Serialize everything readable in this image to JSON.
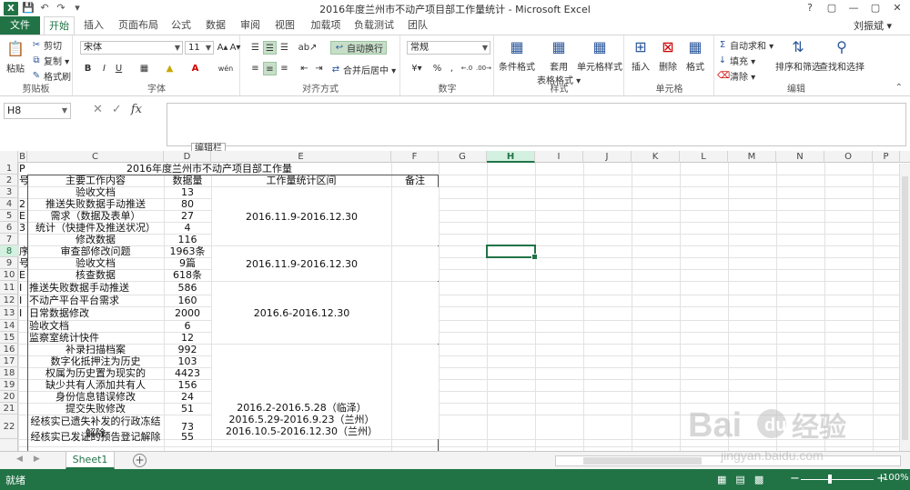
{
  "window": {
    "title": "2016年度兰州市不动产项目部工作量统计 - Microsoft Excel",
    "controls": [
      "?",
      "▢",
      "—",
      "▢",
      "✕"
    ]
  },
  "tabs": [
    {
      "label": "文件"
    },
    {
      "label": "开始"
    },
    {
      "label": "插入"
    },
    {
      "label": "页面布局"
    },
    {
      "label": "公式"
    },
    {
      "label": "数据"
    },
    {
      "label": "审阅"
    },
    {
      "label": "视图"
    },
    {
      "label": "加载项"
    },
    {
      "label": "负载测试"
    },
    {
      "label": "团队"
    }
  ],
  "user": "刘振斌 ▾",
  "ribbon": {
    "clipboard": {
      "label": "剪贴板",
      "paste": "粘贴",
      "cut": "剪切",
      "copy": "复制 ▾",
      "format_painter": "格式刷"
    },
    "font": {
      "label": "字体",
      "name": "宋体",
      "size": "11",
      "grow": "A▴",
      "shrink": "A▾",
      "bold": "B",
      "italic": "I",
      "underline": "U",
      "phonetic": "wén"
    },
    "alignment": {
      "label": "对齐方式",
      "wrap": "自动换行",
      "merge": "合并后居中 ▾"
    },
    "number": {
      "label": "数字",
      "format": "常规",
      "percent": "%",
      "comma": ",",
      "inc": "←.0",
      "dec": ".00→"
    },
    "styles": {
      "label": "样式",
      "cond": "条件格式",
      "table": "套用\n表格格式 ▾",
      "cell": "单元格样式"
    },
    "cells": {
      "label": "单元格",
      "insert": "插入",
      "delete": "删除",
      "format": "格式"
    },
    "editing": {
      "label": "编辑",
      "autosum": "自动求和 ▾",
      "fill": "填充 ▾",
      "clear": "清除 ▾",
      "sort": "排序和筛选",
      "find": "查找和选择"
    }
  },
  "formula_bar": {
    "name_box": "H8",
    "fx": "fx",
    "tooltip": "编辑栏"
  },
  "columns": [
    "B",
    "C",
    "D",
    "E",
    "F",
    "G",
    "H",
    "I",
    "J",
    "K",
    "L",
    "M",
    "N",
    "O",
    "P"
  ],
  "rows": [
    "1",
    "2",
    "3",
    "4",
    "5",
    "6",
    "7",
    "8",
    "9",
    "10",
    "11",
    "12",
    "13",
    "14",
    "15",
    "16",
    "17",
    "18",
    "19",
    "20",
    "21",
    "22"
  ],
  "sheet": {
    "title": "2016年度兰州市不动产项目部工作量",
    "headers": {
      "c": "主要工作内容",
      "d": "数据量",
      "e": "工作量统计区间",
      "f": "备注"
    },
    "rows": [
      {
        "c": "验收文档",
        "d": "13"
      },
      {
        "c": "推送失败数据手动推送",
        "d": "80"
      },
      {
        "c": "需求（数据及表单）",
        "d": "27"
      },
      {
        "c": "统计（快捷件及推送状况）",
        "d": "4"
      },
      {
        "c": "修改数据",
        "d": "116"
      },
      {
        "c": "审查部修改问题",
        "d": "1963条"
      },
      {
        "c": "验收文档",
        "d": "9篇"
      },
      {
        "c": "核查数据",
        "d": "618条"
      },
      {
        "c": "推送失败数据手动推送",
        "d": "586"
      },
      {
        "c": "不动产平台平台需求",
        "d": "160"
      },
      {
        "c": "日常数据修改",
        "d": "2000"
      },
      {
        "c": "验收文档",
        "d": "6"
      },
      {
        "c": "监察室统计快件",
        "d": "12"
      },
      {
        "c": "补录扫描档案",
        "d": "992"
      },
      {
        "c": "数字化抵押注为历史",
        "d": "103"
      },
      {
        "c": "权属为历史置为现实的",
        "d": "4423"
      },
      {
        "c": "缺少共有人添加共有人",
        "d": "156"
      },
      {
        "c": "身份信息错误修改",
        "d": "24"
      },
      {
        "c": "提交失败修改",
        "d": "51"
      },
      {
        "c": "经核实已遗失补发的行政冻结\n解除",
        "d": "73"
      },
      {
        "c": "经核实已发证的预告登记解除",
        "d": "55"
      }
    ],
    "periods": {
      "p1": "2016.11.9-2016.12.30",
      "p2": "2016.11.9-2016.12.30",
      "p3": "2016.6-2016.12.30",
      "p4": "2016.2-2016.5.28（临泽）\n2016.5.29-2016.9.23（兰州）\n2016.10.5-2016.12.30（兰州）"
    },
    "col_b_fragments": [
      "P",
      "号",
      "2",
      "E",
      "3",
      "序",
      "号",
      "E",
      "I",
      "I",
      "I"
    ]
  },
  "sheet_tabs": {
    "active": "Sheet1",
    "add": "+"
  },
  "status": {
    "text": "就绪",
    "zoom": "100%",
    "zoom_minus": "−",
    "zoom_plus": "+"
  },
  "watermark": {
    "text": "Bai 经验",
    "sub": "jingyan.baidu.com"
  }
}
